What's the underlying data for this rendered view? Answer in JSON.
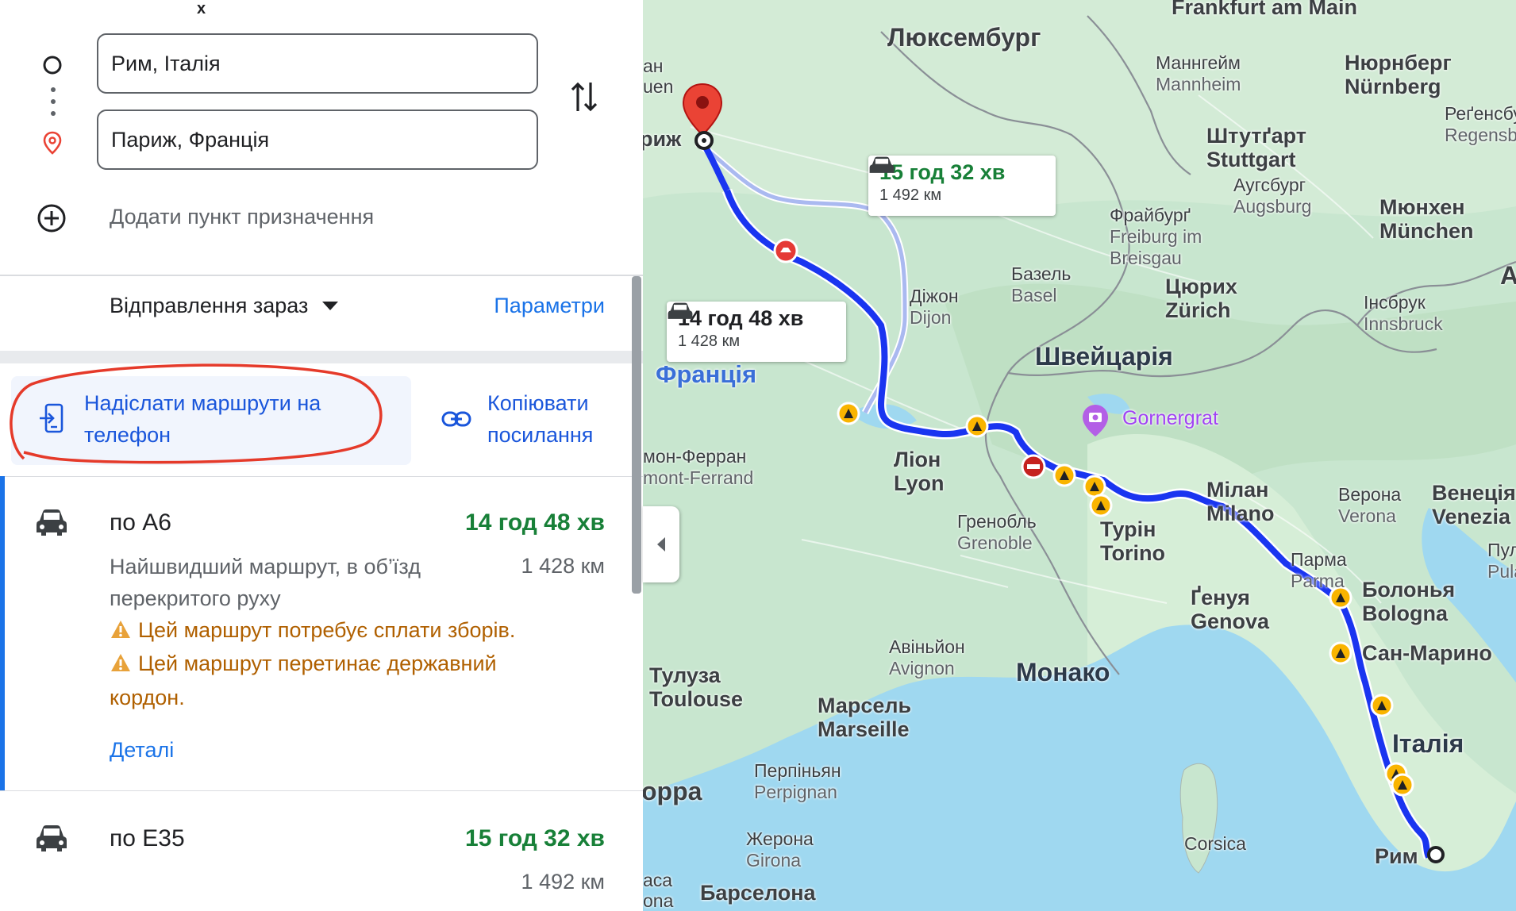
{
  "panel": {
    "close_label": "x",
    "origin_value": "Рим, Італія",
    "destination_value": "Париж, Франція",
    "add_destination": "Додати пункт призначення",
    "depart_label": "Відправлення зараз",
    "options_label": "Параметри",
    "send_to_phone": "Надіслати маршрути на телефон",
    "copy_link": "Копіювати посилання"
  },
  "routes": [
    {
      "name": "по A6",
      "time": "14 год 48 хв",
      "distance": "1 428 км",
      "description": "Найшвидший маршрут, в об’їзд перекритого руху",
      "warnings": [
        "Цей маршрут потребує сплати зборів.",
        "Цей маршрут перетинає державний кордон."
      ],
      "details_label": "Деталі"
    },
    {
      "name": "по E35",
      "time": "15 год 32 хв",
      "distance": "1 492 км"
    }
  ],
  "map": {
    "callout_alt": {
      "time": "15 год 32 хв",
      "distance": "1 492 км"
    },
    "callout_main": {
      "time": "14 год 48 хв",
      "distance": "1 428 км"
    },
    "labels": {
      "frankfurt": "Frankfurt am Main",
      "luxembourg": "Люксембург",
      "mannheim_uk": "Маннгейм",
      "mannheim": "Mannheim",
      "nurnberg_uk": "Нюрнберг",
      "nurnberg": "Nürnberg",
      "regensburg_uk": "Реґенсбург",
      "regensburg": "Regensburg",
      "stuttgart_uk": "Штутґарт",
      "stuttgart": "Stuttgart",
      "augsburg_uk": "Аугсбург",
      "augsburg": "Augsburg",
      "freiburg_uk": "Фрайбурґ",
      "freiburg": "Freiburg im Breisgau",
      "munchen_uk": "Мюнхен",
      "munchen": "München",
      "basel_uk": "Базель",
      "basel": "Basel",
      "zurich_uk": "Цюрих",
      "zurich": "Zürich",
      "innsbruck_uk": "Інсбрук",
      "innsbruck": "Innsbruck",
      "paris_short": "риж",
      "left_cut_1": "ан",
      "left_cut_2": "uen",
      "dijon_uk": "Діжон",
      "dijon": "Dijon",
      "france": "Франція",
      "switzerland": "Швейцарія",
      "gornergrat": "Gornergrat",
      "clermont_uk": "мон-Ферран",
      "clermont": "mont-Ferrand",
      "lyon_uk": "Ліон",
      "lyon": "Lyon",
      "milan_uk": "Мілан",
      "milan": "Milano",
      "verona_uk": "Верона",
      "verona": "Verona",
      "venice_uk": "Венеція",
      "venice": "Venezia",
      "pula_uk": "Пула",
      "pula": "Pula",
      "grenoble_uk": "Гренобль",
      "grenoble": "Grenoble",
      "turin_uk": "Турін",
      "turin": "Torino",
      "parma_uk": "Парма",
      "parma": "Parma",
      "genova_uk": "Ґенуя",
      "genova": "Genova",
      "bologna_uk": "Болонья",
      "bologna": "Bologna",
      "avignon_uk": "Авіньйон",
      "avignon": "Avignon",
      "monaco": "Монако",
      "san_marino": "Сан-Марино",
      "toulouse_uk": "Тулуза",
      "toulouse": "Toulouse",
      "marseille_uk": "Марсель",
      "marseille": "Marseille",
      "italy": "Італія",
      "perpignan_uk": "Перпіньян",
      "perpignan": "Perpignan",
      "andorra": "орра",
      "corsica": "Corsica",
      "rome": "Рим",
      "girona_uk": "Жерона",
      "girona": "Girona",
      "barcelona": "Барселона",
      "aca": "aca",
      "ona": "ona",
      "a_edge": "A"
    }
  },
  "colors": {
    "route": "#1a35f0",
    "alt_route": "#aab9f0",
    "link": "#1a73e8",
    "time_green": "#188038",
    "warning": "#b06000",
    "marker_red": "#ea4335"
  }
}
